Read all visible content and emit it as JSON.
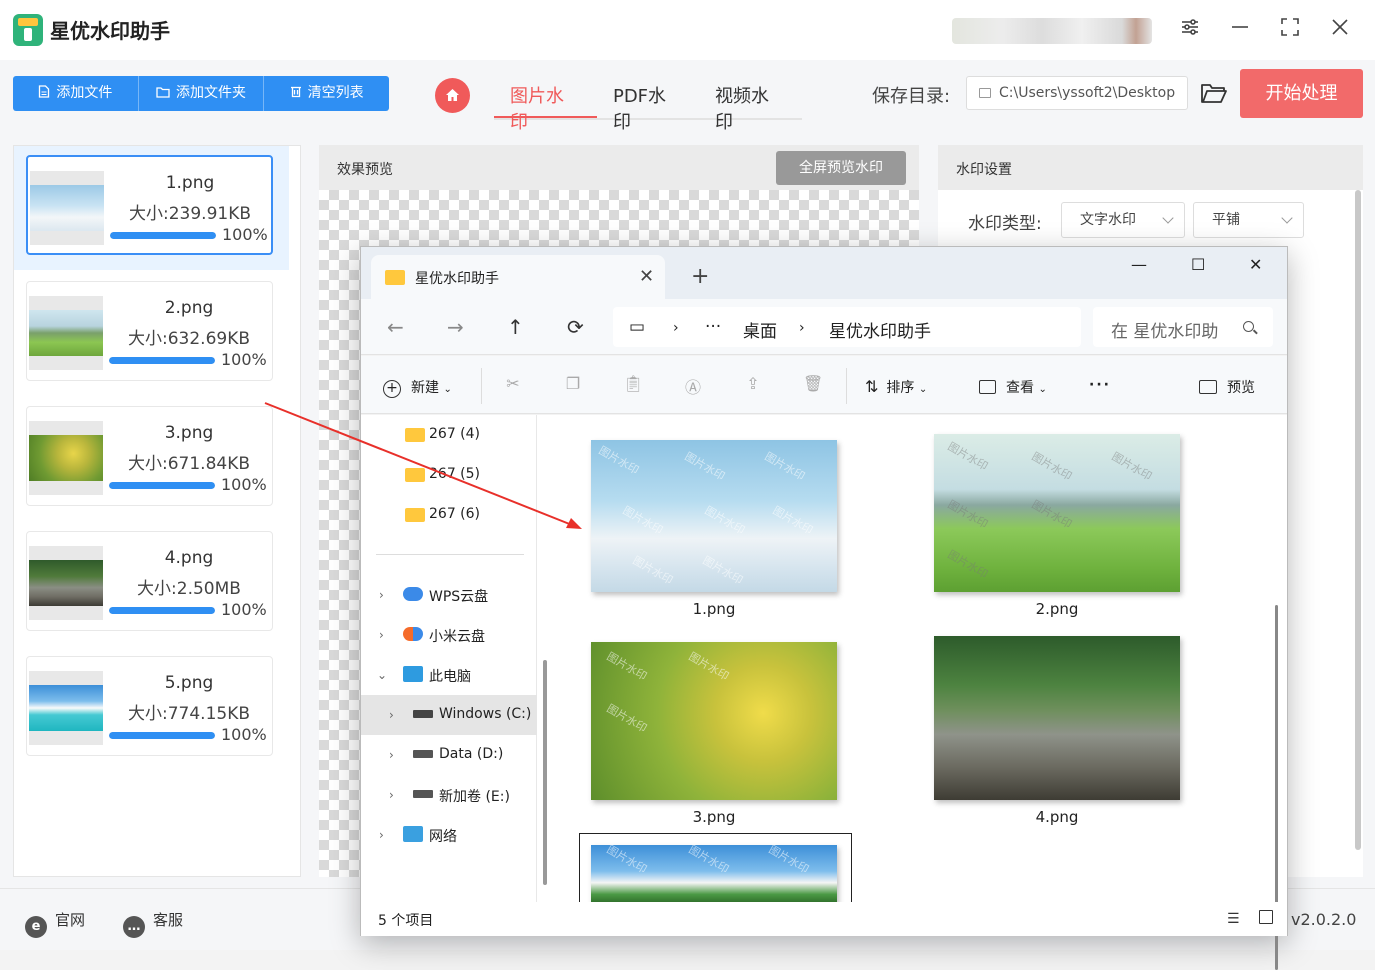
{
  "app": {
    "title": "星优水印助手"
  },
  "toolbar": {
    "add_file": "添加文件",
    "add_folder": "添加文件夹",
    "clear_list": "清空列表",
    "tabs": [
      "图片水印",
      "PDF水印",
      "视频水印"
    ],
    "save_label": "保存目录:",
    "save_path": "C:\\Users\\yssoft2\\Desktop",
    "start": "开始处理"
  },
  "files": [
    {
      "name": "1.png",
      "size": "大小:239.91KB",
      "pct": "100%",
      "progress": 1.0
    },
    {
      "name": "2.png",
      "size": "大小:632.69KB",
      "pct": "100%",
      "progress": 1.0
    },
    {
      "name": "3.png",
      "size": "大小:671.84KB",
      "pct": "100%",
      "progress": 1.0
    },
    {
      "name": "4.png",
      "size": "大小:2.50MB",
      "pct": "100%",
      "progress": 1.0
    },
    {
      "name": "5.png",
      "size": "大小:774.15KB",
      "pct": "100%",
      "progress": 1.0
    }
  ],
  "preview": {
    "title": "效果预览",
    "fullscreen": "全屏预览水印"
  },
  "settings": {
    "title": "水印设置",
    "type_label": "水印类型:",
    "type_value": "文字水印",
    "layout_value": "平铺"
  },
  "footer": {
    "site": "官网",
    "service": "客服",
    "version": "v2.0.2.0"
  },
  "explorer": {
    "tab_title": "星优水印助手",
    "breadcrumb": [
      "桌面",
      "星优水印助手"
    ],
    "search_placeholder": "在 星优水印助手 中搜索",
    "cmd": {
      "new": "新建",
      "sort": "排序",
      "view": "查看",
      "preview": "预览"
    },
    "nav": [
      {
        "label": "267 (4)"
      },
      {
        "label": "267 (5)"
      },
      {
        "label": "267 (6)"
      },
      {
        "label": "WPS云盘"
      },
      {
        "label": "小米云盘"
      },
      {
        "label": "此电脑"
      },
      {
        "label": "Windows (C:)"
      },
      {
        "label": "Data (D:)"
      },
      {
        "label": "新加卷 (E:)"
      },
      {
        "label": "网络"
      }
    ],
    "files": [
      "1.png",
      "2.png",
      "3.png",
      "4.png"
    ],
    "watermark_text": "图片水印",
    "status": "5 个项目"
  },
  "colors": {
    "accent_blue": "#2f8ff3",
    "accent_red": "#f05a5a",
    "start_btn": "#f26a6a"
  }
}
